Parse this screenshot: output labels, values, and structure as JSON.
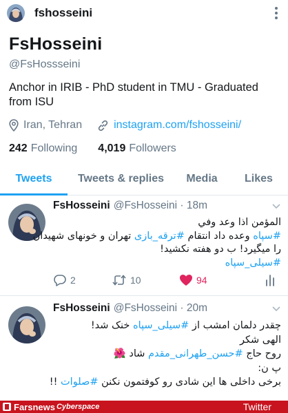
{
  "topbar": {
    "handle": "fshosseini"
  },
  "profile": {
    "display_name": "FsHosseini",
    "username": "@FsHossseini",
    "bio": "Anchor in IRIB - PhD student in TMU - Graduated from ISU",
    "location": "Iran, Tehran",
    "link": "instagram.com/fshosseini/",
    "following_count": "242",
    "following_label": "Following",
    "followers_count": "4,019",
    "followers_label": "Followers"
  },
  "tabs": [
    "Tweets",
    "Tweets & replies",
    "Media",
    "Likes"
  ],
  "tweets": [
    {
      "name": "FsHosseini",
      "meta": "@FsHosseini · 18m",
      "line1": "المؤمن اذا وعد وفي",
      "line2_tag1": "#سپاه",
      "line2_text1": " وعده داد انتقام ",
      "line2_tag2": "#ترقه_بازی",
      "line2_text2": " تهران و خونهای شهیدان",
      "line3": "را میگیرد! ب دو هفته نکشید!",
      "line4_tag": "#سیلی_سپاه",
      "replies": "2",
      "retweets": "10",
      "likes": "94"
    },
    {
      "name": "FsHosseini",
      "meta": "@FsHosseini · 20m",
      "line1_text1": "چقدر دلمان امشب از ",
      "line1_tag": "#سیلی_سپاه",
      "line1_text2": " خنک شد!",
      "line2": "الهی شکر",
      "line3_text1": "روح حاج ",
      "line3_tag": "#حسن_طهرانی_مقدم",
      "line3_text2": " شاد 🌺",
      "line4": "پ ن:",
      "line5_text1": "برخی داخلی ها این شادی رو کوفتمون نکنن ",
      "line5_tag": "#صلوات",
      "line5_text2": " !!"
    }
  ],
  "ribbon": {
    "brand": "Farsnews",
    "sub": "Cyberspace",
    "right": "Twitter"
  },
  "colors": {
    "accent": "#1da1f2",
    "like": "#e0245e",
    "ribbon": "#c8141e"
  }
}
